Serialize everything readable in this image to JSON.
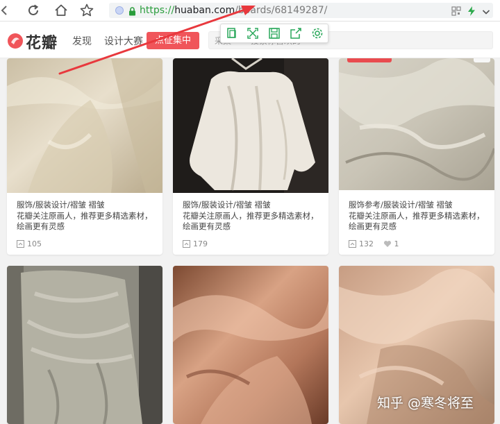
{
  "browser": {
    "url_scheme": "https://",
    "url_host": "huaban.com",
    "url_path": "/boards/68149287/",
    "buttons": [
      "back",
      "reload",
      "home",
      "bookmark"
    ]
  },
  "header": {
    "logo": "花瓣",
    "nav": [
      "发现",
      "设计大赛"
    ],
    "campaign_button": "点征集中",
    "search_hint_1": "采集",
    "search_hint_2": "搜索你喜欢的"
  },
  "extension_toolbar": {
    "icons": [
      "copy-icon",
      "expand-icon",
      "save-icon",
      "share-icon",
      "settings-icon"
    ],
    "accent": "#27a658"
  },
  "pins": [
    {
      "category": "服饰/服装设计/褶皱 褶皱",
      "line2": "花瓣关注原画人，推荐更多精选素材，",
      "line3": "绘画更有灵感",
      "repins": "105",
      "likes": ""
    },
    {
      "category": "服饰/服装设计/褶皱 褶皱",
      "line2": "花瓣关注原画人，推荐更多精选素材，",
      "line3": "绘画更有灵感",
      "repins": "179",
      "likes": ""
    },
    {
      "category": "服饰参考/服装设计/褶皱 褶皱",
      "line2": "花瓣关注原画人，推荐更多精选素材，",
      "line3": "绘画更有灵感",
      "repins": "132",
      "likes": "1"
    }
  ],
  "watermark": "知乎 @寒冬将至",
  "colors": {
    "brand": "#f0555a",
    "annotation_arrow": "#e8383d"
  }
}
